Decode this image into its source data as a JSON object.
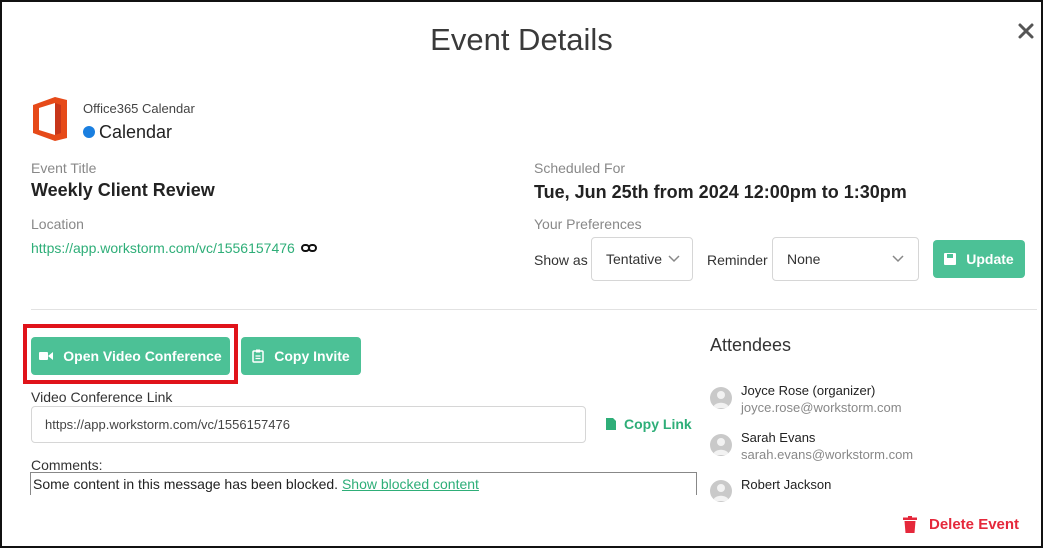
{
  "modal": {
    "title": "Event Details"
  },
  "calendar": {
    "source": "Office365 Calendar",
    "name": "Calendar",
    "dot_color": "#1a7fe0",
    "office_color": "#e64a19"
  },
  "event": {
    "title_label": "Event Title",
    "title": "Weekly Client Review",
    "location_label": "Location",
    "location_url": "https://app.workstorm.com/vc/1556157476",
    "scheduled_label": "Scheduled For",
    "scheduled_value": "Tue, Jun 25th from 2024 12:00pm to 1:30pm"
  },
  "preferences": {
    "label": "Your Preferences",
    "show_as_label": "Show as",
    "show_as_value": "Tentative",
    "reminder_label": "Reminder",
    "reminder_value": "None",
    "update_label": "Update"
  },
  "conference": {
    "open_label": "Open Video Conference",
    "copy_invite_label": "Copy Invite",
    "link_label": "Video Conference Link",
    "link_value": "https://app.workstorm.com/vc/1556157476",
    "copy_link_label": "Copy Link"
  },
  "comments": {
    "label": "Comments:",
    "blocked_text": "Some content in this message has been blocked.",
    "show_blocked_label": "Show blocked content"
  },
  "attendees": {
    "heading": "Attendees",
    "list": [
      {
        "name": "Joyce Rose (organizer)",
        "email": "joyce.rose@workstorm.com"
      },
      {
        "name": "Sarah Evans",
        "email": "sarah.evans@workstorm.com"
      },
      {
        "name": "Robert Jackson",
        "email": ""
      }
    ]
  },
  "footer": {
    "delete_label": "Delete Event"
  },
  "colors": {
    "accent": "#4cc196",
    "link": "#2eae78",
    "danger": "#e5283b",
    "highlight": "#e0131a"
  }
}
